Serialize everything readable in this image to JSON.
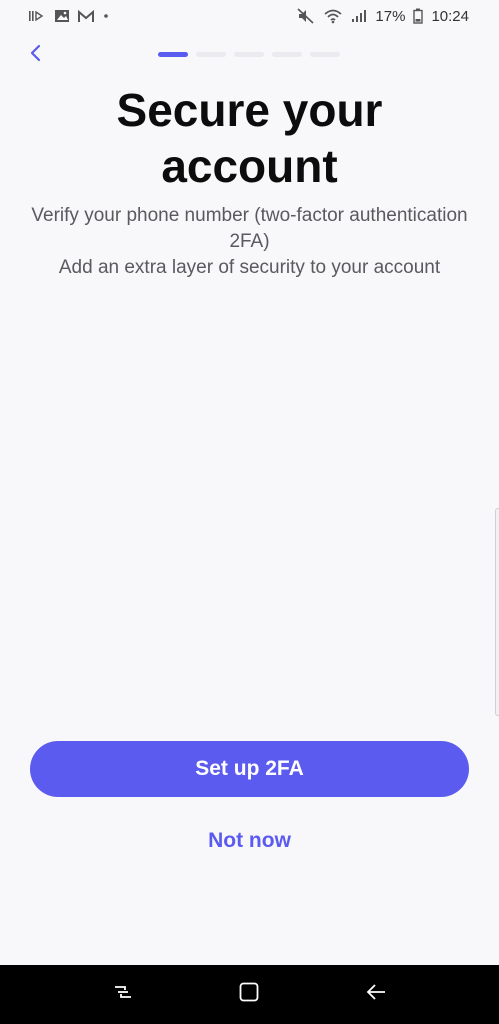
{
  "status_bar": {
    "battery": "17%",
    "time": "10:24",
    "left_icons": [
      "media-icon",
      "image-icon",
      "gmail-icon",
      "dot-icon"
    ],
    "right_icons": [
      "mute-icon",
      "wifi-icon",
      "signal-icon",
      "battery-icon"
    ]
  },
  "header": {
    "back_icon": "chevron-left-icon",
    "progress_steps": 5,
    "progress_current": 1
  },
  "title": "Secure your account",
  "subtitle_lines": [
    "Verify your phone number (two-factor authentication 2FA)",
    "Add an extra layer of security to your account"
  ],
  "actions": {
    "primary_label": "Set up 2FA",
    "secondary_label": "Not now"
  },
  "nav_bar": {
    "icons": [
      "recents-icon",
      "home-icon",
      "back-arrow-icon"
    ]
  },
  "colors": {
    "accent": "#5b5bf0",
    "background": "#f8f8fa",
    "title": "#0c0c0c",
    "subtitle": "#5a5a5e"
  }
}
